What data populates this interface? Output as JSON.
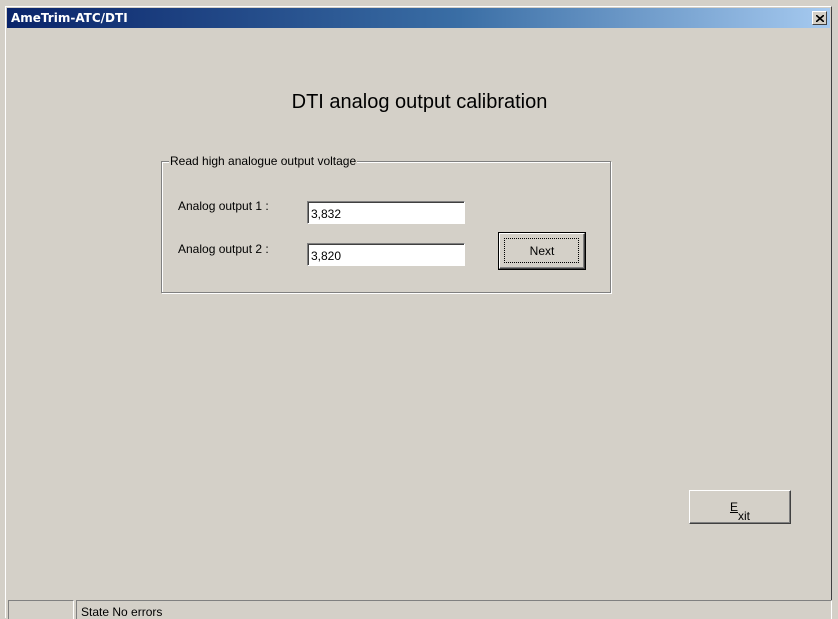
{
  "window": {
    "title": "AmeTrim-ATC/DTI",
    "close_icon": "close-icon"
  },
  "main": {
    "title": "DTI analog output calibration",
    "group": {
      "legend": "Read high analogue output voltage",
      "rows": [
        {
          "label": "Analog output 1 :",
          "value": "3,832"
        },
        {
          "label": "Analog output 2 :",
          "value": "3,820"
        }
      ],
      "next_label": "Next"
    },
    "exit_label": "Exit",
    "exit_mnemonic": "E",
    "exit_rest": "xit"
  },
  "statusbar": {
    "cell1": "",
    "cell2": "State No errors"
  }
}
